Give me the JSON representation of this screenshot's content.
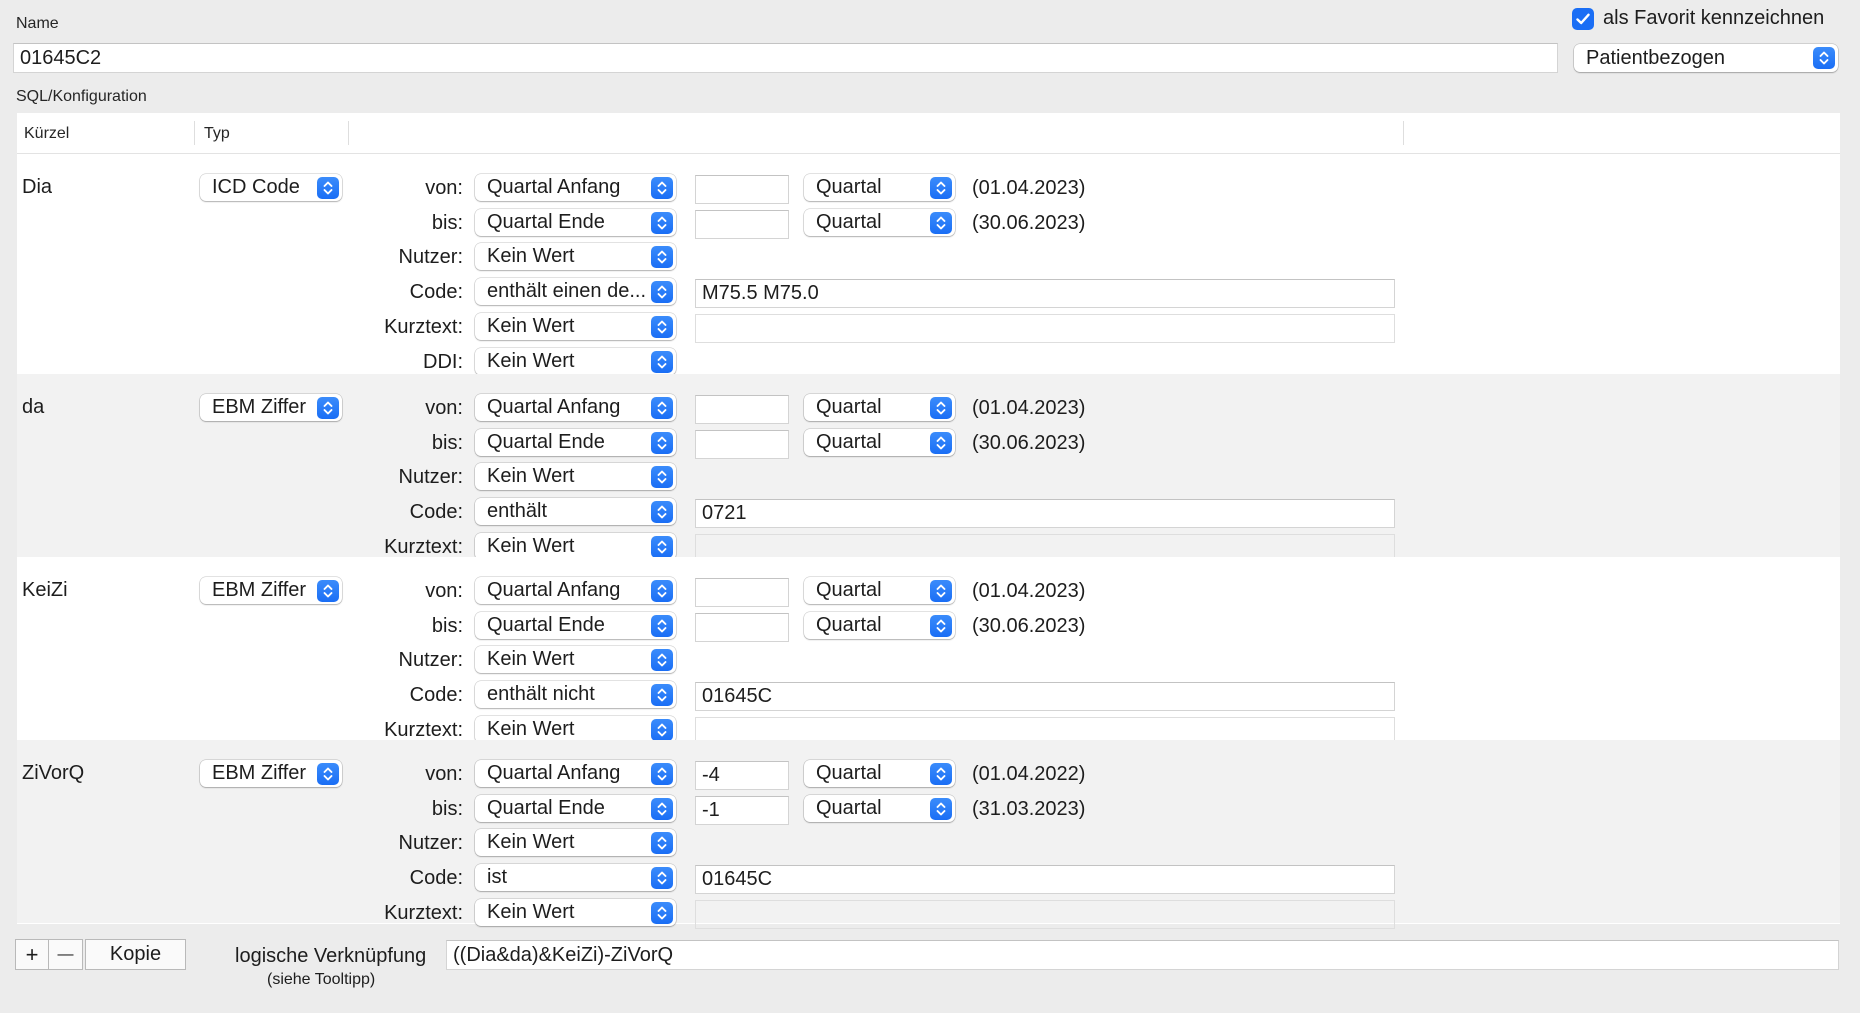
{
  "header": {
    "name_label": "Name",
    "name_value": "01645C2",
    "favorite_label": "als Favorit kennzeichnen",
    "favorite_checked": true,
    "scope_value": "Patientbezogen",
    "sql_label": "SQL/Konfiguration"
  },
  "table": {
    "col_kuerzel": "Kürzel",
    "col_typ": "Typ"
  },
  "rows": [
    {
      "kuerzel": "Dia",
      "typ": "ICD Code",
      "von_label": "von:",
      "von_value": "Quartal Anfang",
      "von_offset": "",
      "von_unit": "Quartal",
      "von_date": "(01.04.2023)",
      "bis_label": "bis:",
      "bis_value": "Quartal Ende",
      "bis_offset": "",
      "bis_unit": "Quartal",
      "bis_date": "(30.06.2023)",
      "nutzer_label": "Nutzer:",
      "nutzer_value": "Kein Wert",
      "code_label": "Code:",
      "code_op": "enthält einen de...",
      "code_value": "M75.5 M75.0",
      "kurztext_label": "Kurztext:",
      "kurztext_value": "Kein Wert",
      "kurztext_text": "",
      "ddi_label": "DDI:",
      "ddi_value": "Kein Wert"
    },
    {
      "kuerzel": "da",
      "typ": "EBM Ziffer",
      "von_label": "von:",
      "von_value": "Quartal Anfang",
      "von_offset": "",
      "von_unit": "Quartal",
      "von_date": "(01.04.2023)",
      "bis_label": "bis:",
      "bis_value": "Quartal Ende",
      "bis_offset": "",
      "bis_unit": "Quartal",
      "bis_date": "(30.06.2023)",
      "nutzer_label": "Nutzer:",
      "nutzer_value": "Kein Wert",
      "code_label": "Code:",
      "code_op": "enthält",
      "code_value": "0721",
      "kurztext_label": "Kurztext:",
      "kurztext_value": "Kein Wert",
      "kurztext_text": ""
    },
    {
      "kuerzel": "KeiZi",
      "typ": "EBM Ziffer",
      "von_label": "von:",
      "von_value": "Quartal Anfang",
      "von_offset": "",
      "von_unit": "Quartal",
      "von_date": "(01.04.2023)",
      "bis_label": "bis:",
      "bis_value": "Quartal Ende",
      "bis_offset": "",
      "bis_unit": "Quartal",
      "bis_date": "(30.06.2023)",
      "nutzer_label": "Nutzer:",
      "nutzer_value": "Kein Wert",
      "code_label": "Code:",
      "code_op": "enthält nicht",
      "code_value": "01645C",
      "kurztext_label": "Kurztext:",
      "kurztext_value": "Kein Wert",
      "kurztext_text": ""
    },
    {
      "kuerzel": "ZiVorQ",
      "typ": "EBM Ziffer",
      "von_label": "von:",
      "von_value": "Quartal Anfang",
      "von_offset": "-4",
      "von_unit": "Quartal",
      "von_date": "(01.04.2022)",
      "bis_label": "bis:",
      "bis_value": "Quartal Ende",
      "bis_offset": "-1",
      "bis_unit": "Quartal",
      "bis_date": "(31.03.2023)",
      "nutzer_label": "Nutzer:",
      "nutzer_value": "Kein Wert",
      "code_label": "Code:",
      "code_op": "ist",
      "code_value": "01645C",
      "kurztext_label": "Kurztext:",
      "kurztext_value": "Kein Wert",
      "kurztext_text": ""
    }
  ],
  "footer": {
    "add_label": "+",
    "remove_label": "—",
    "copy_label": "Kopie",
    "logic_label": "logische Verknüpfung",
    "logic_hint": "(siehe Tooltipp)",
    "logic_value": "((Dia&da)&KeiZi)-ZiVorQ"
  },
  "colors": {
    "accent": "#1a6ef5",
    "window_bg": "#ececec",
    "row_alt": "#f2f2f2"
  }
}
